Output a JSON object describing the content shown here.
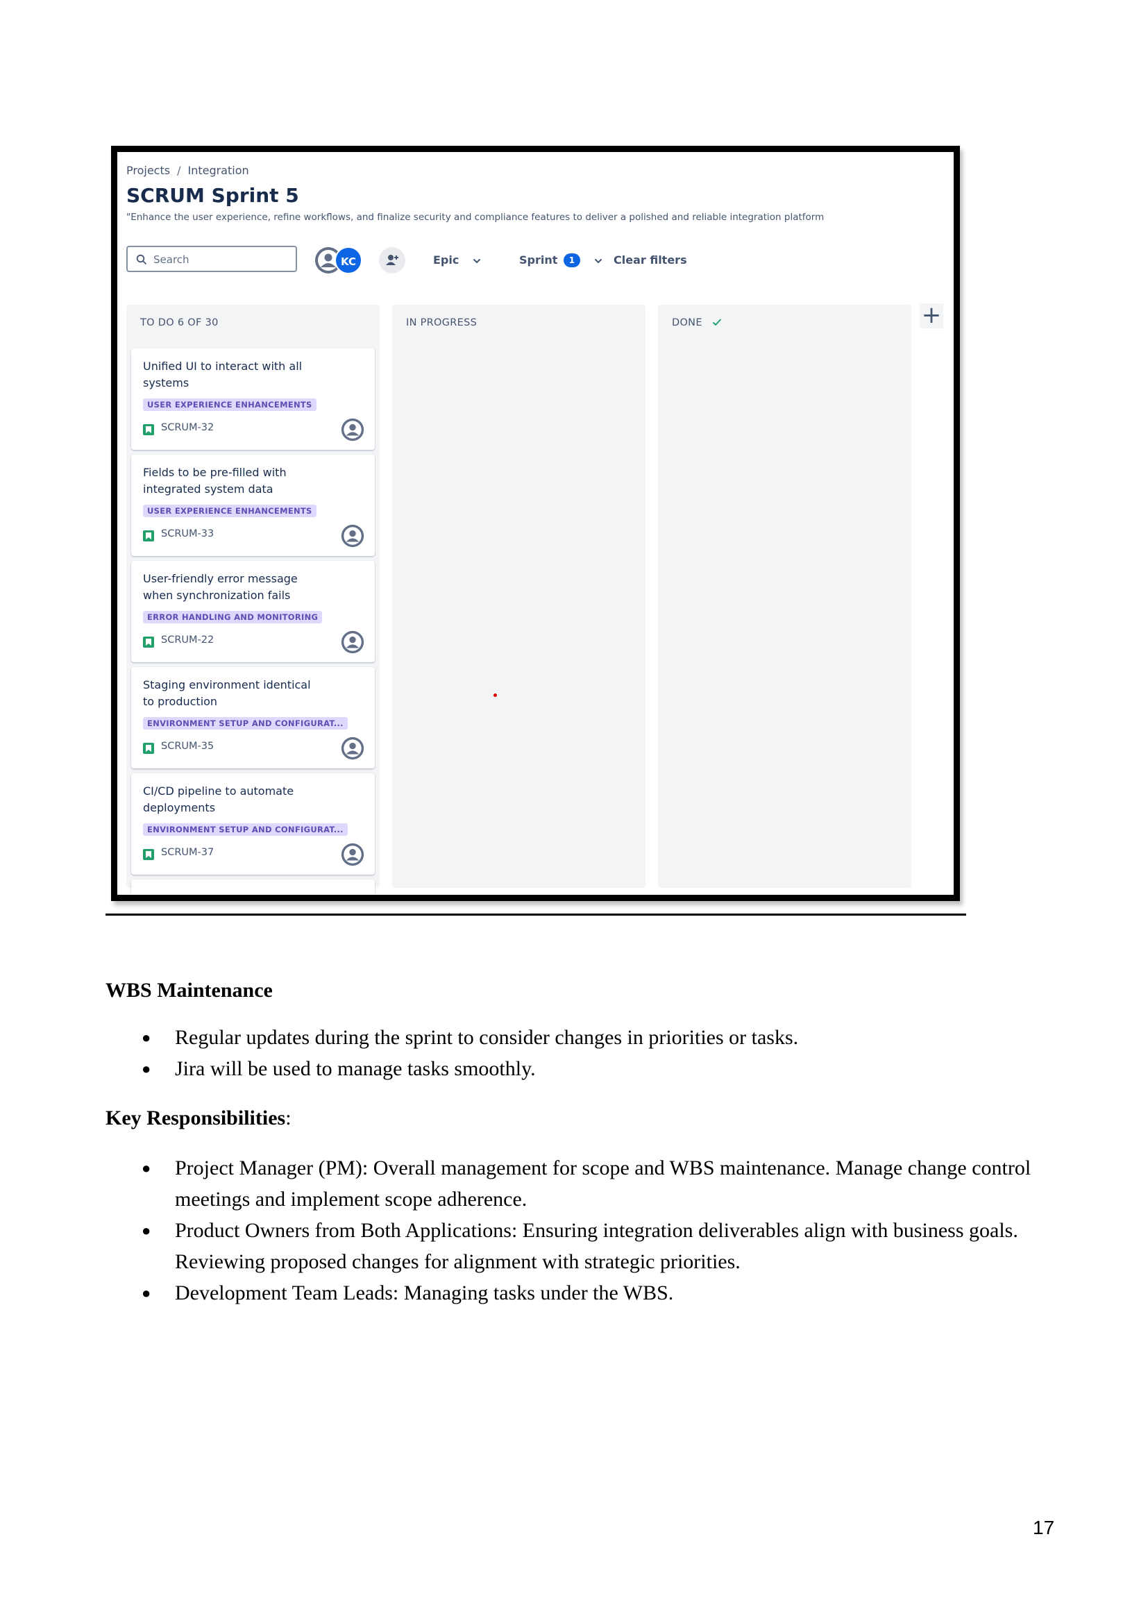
{
  "jira": {
    "breadcrumb": {
      "projects": "Projects",
      "sep": "/",
      "integration": "Integration"
    },
    "title": "SCRUM Sprint 5",
    "subtitle": "\"Enhance the user experience, refine workflows, and finalize security and compliance features to deliver a polished and reliable integration platform",
    "toolbar": {
      "search_placeholder": "Search",
      "avatar_initials": "KC",
      "epic_label": "Epic",
      "sprint_label": "Sprint",
      "sprint_count": "1",
      "clear_filters": "Clear filters"
    },
    "columns": [
      {
        "label": "TO DO 6 OF 30"
      },
      {
        "label": "IN PROGRESS"
      },
      {
        "label": "DONE"
      }
    ],
    "cards": [
      {
        "title": "Unified UI to interact with all systems",
        "epic": "USER EXPERIENCE ENHANCEMENTS",
        "key": "SCRUM-32"
      },
      {
        "title": "Fields to be pre-filled with integrated system data",
        "epic": "USER EXPERIENCE ENHANCEMENTS",
        "key": "SCRUM-33"
      },
      {
        "title": "User-friendly error message when synchronization fails",
        "epic": "ERROR HANDLING AND MONITORING",
        "key": "SCRUM-22"
      },
      {
        "title": "Staging environment identical to production",
        "epic": "ENVIRONMENT SETUP AND CONFIGURAT...",
        "key": "SCRUM-35"
      },
      {
        "title": "CI/CD pipeline to automate deployments",
        "epic": "ENVIRONMENT SETUP AND CONFIGURAT...",
        "key": "SCRUM-37"
      }
    ],
    "colors": {
      "accent": "#0c66e4",
      "epic_bg": "#dfd8fd",
      "epic_text": "#5e4db2",
      "story": "#22a06b"
    }
  },
  "doc": {
    "wbs_heading": "WBS Maintenance",
    "wbs_items": [
      "Regular updates during the sprint to consider changes in priorities or tasks.",
      "Jira will be used to manage tasks smoothly."
    ],
    "resp_heading": "Key Responsibilities",
    "resp_colon": ":",
    "resp_items": [
      "Project Manager (PM): Overall management for scope and WBS maintenance. Manage change control meetings and implement scope adherence.",
      "Product Owners from Both Applications: Ensuring integration deliverables align with business goals. Reviewing proposed changes for alignment with strategic priorities.",
      "Development Team Leads: Managing tasks under the WBS."
    ],
    "page_number": "17"
  }
}
